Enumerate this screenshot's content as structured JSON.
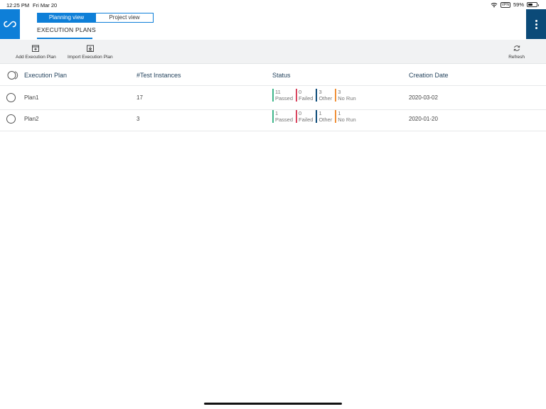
{
  "statusbar": {
    "time": "12:25 PM",
    "date": "Fri Mar 20",
    "battery": "59%",
    "battery_level": 0.59
  },
  "header": {
    "views": [
      "Planning view",
      "Project view"
    ],
    "active_view": "Planning view",
    "tab_title": "EXECUTION PLANS"
  },
  "toolbar": {
    "add_label": "Add Execution Plan",
    "import_label": "Import Execution Plan",
    "refresh_label": "Refresh"
  },
  "table": {
    "columns": {
      "plan": "Execution Plan",
      "instances": "#Test Instances",
      "status": "Status",
      "date": "Creation Date"
    },
    "rows": [
      {
        "name": "Plan1",
        "instances": "17",
        "passed": "11",
        "failed": "0",
        "other": "3",
        "norun": "3",
        "date": "2020-03-02"
      },
      {
        "name": "Plan2",
        "instances": "3",
        "passed": "1",
        "failed": "0",
        "other": "1",
        "norun": "1",
        "date": "2020-01-20"
      }
    ],
    "status_labels": {
      "passed": "Passed",
      "failed": "Failed",
      "other": "Other",
      "norun": "No Run"
    }
  },
  "colors": {
    "accent": "#0e7fd8",
    "menu": "#0b4a78",
    "passed": "#3fb68b",
    "failed": "#d9455f",
    "other": "#0b4a78",
    "norun": "#f0913a"
  }
}
